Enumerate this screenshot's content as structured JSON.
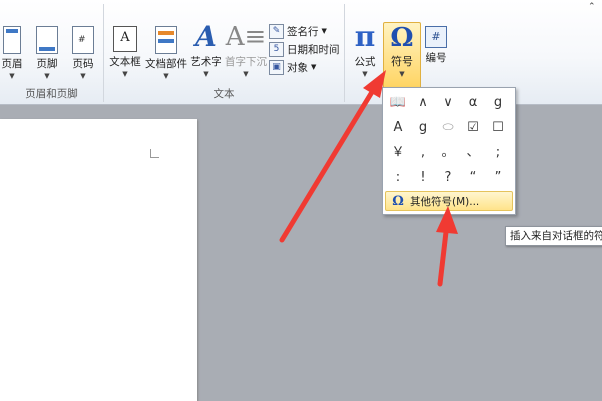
{
  "ribbon": {
    "groups": {
      "header_footer": "页眉和页脚",
      "text": "文本"
    },
    "buttons": {
      "header": "页眉",
      "footer": "页脚",
      "page_number": "页码",
      "textbox": "文本框",
      "quick_parts": "文档部件",
      "wordart": "艺术字",
      "dropcap": "首字下沉",
      "signature": "签名行",
      "datetime": "日期和时间",
      "object": "对象",
      "equation": "公式",
      "symbol": "符号",
      "number": "编号"
    }
  },
  "symbol_menu": {
    "symbols": [
      "📖",
      "∧",
      "∨",
      "α",
      "g",
      "A",
      "g",
      "⬭",
      "☑",
      "☐",
      "￥",
      ",",
      "。",
      "、",
      ";",
      ":",
      "!",
      "?",
      "“",
      "”"
    ],
    "more_label": "其他符号(M)..."
  },
  "tooltip": "插入来自对话框的符号",
  "colors": {
    "accent": "#1f4fb0",
    "highlight": "#ffd35e",
    "arrow": "#f03a32"
  }
}
